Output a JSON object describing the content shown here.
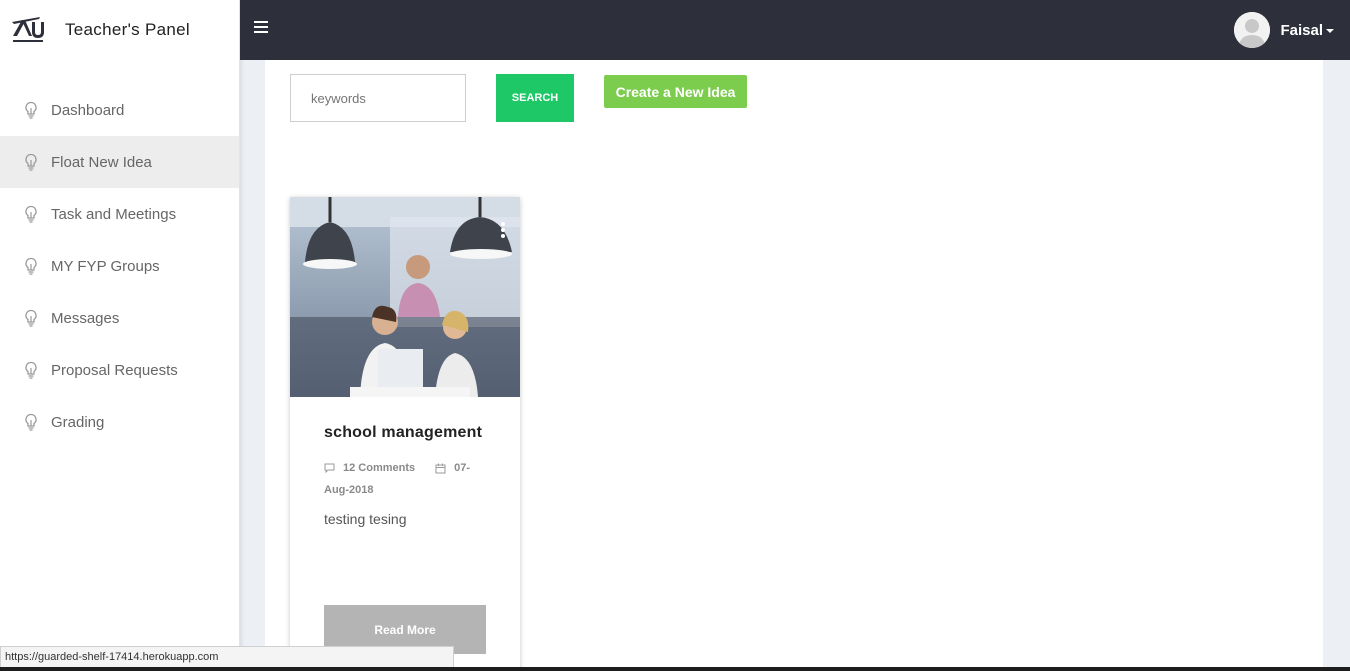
{
  "sidebar": {
    "title": "Teacher's Panel",
    "items": [
      {
        "label": "Dashboard"
      },
      {
        "label": "Float New Idea"
      },
      {
        "label": "Task and Meetings"
      },
      {
        "label": "MY FYP Groups"
      },
      {
        "label": "Messages"
      },
      {
        "label": "Proposal Requests"
      },
      {
        "label": "Grading"
      }
    ],
    "active_index": 1,
    "item_icon": "lightbulb-icon"
  },
  "topbar": {
    "menu_icon": "hamburger-icon",
    "user_name": "Faisal"
  },
  "search": {
    "placeholder": "keywords",
    "button_label": "SEARCH"
  },
  "create_button_label": "Create a New Idea",
  "card": {
    "title": "school management",
    "comments": "12 Comments",
    "date": "07-Aug-2018",
    "description": "testing tesing",
    "read_more_label": "Read More"
  },
  "status_url": "https://guarded-shelf-17414.herokuapp.com",
  "colors": {
    "topbar": "#2d2f3b",
    "search_button": "#1ec866",
    "create_button": "#7ccc4e",
    "read_more": "#b4b4b4",
    "active_item": "#ededed"
  }
}
